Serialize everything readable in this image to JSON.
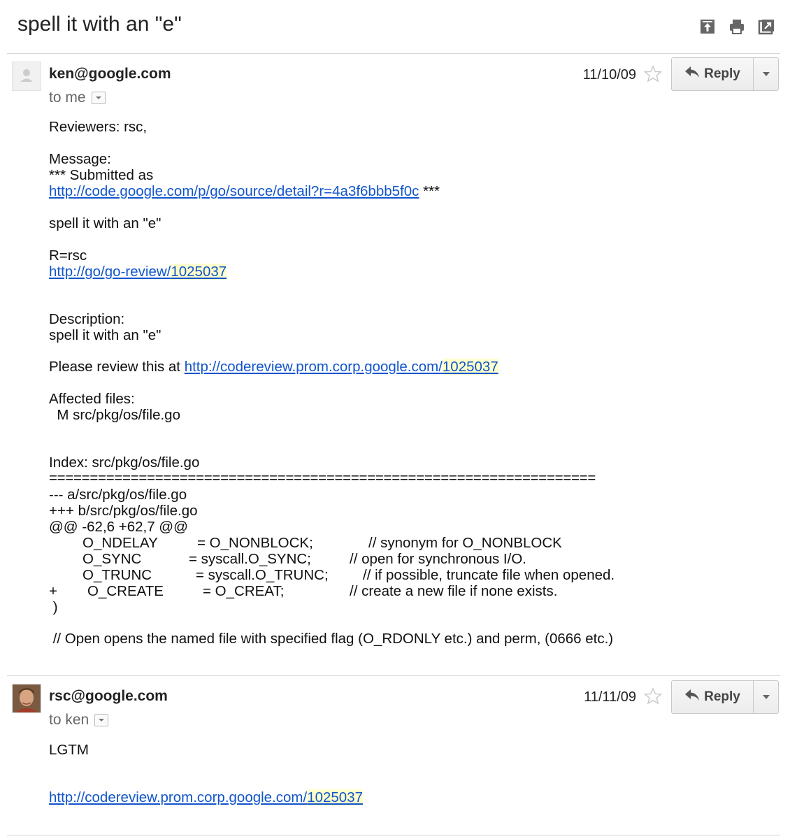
{
  "subject": "spell it with an \"e\"",
  "toolbar": {
    "icons": [
      "archive-up-icon",
      "print-icon",
      "open-new-window-icon"
    ]
  },
  "messages": [
    {
      "sender": "ken@google.com",
      "date": "11/10/09",
      "reply_label": "Reply",
      "to_label": "to me",
      "body": {
        "reviewers": "Reviewers: rsc,",
        "message_label": "Message:",
        "submitted_prefix": "*** Submitted as",
        "submitted_link": "http://code.google.com/p/go/source/detail?r=4a3f6bbb5f0c",
        "submitted_suffix": " ***",
        "summary": "spell it with an \"e\"",
        "r_line": "R=rsc",
        "review_link_base": "http://go/go-review/",
        "review_link_id": "1025037",
        "description_label": "Description:",
        "description_text": "spell it with an \"e\"",
        "please_review_prefix": "Please review this at ",
        "please_review_base": "http://codereview.prom.corp.google.com/",
        "please_review_id": "1025037",
        "affected_label": "Affected files:",
        "affected_file": "  M src/pkg/os/file.go",
        "index_line": "Index: src/pkg/os/file.go",
        "separator": "===================================================================",
        "minus_line": "--- a/src/pkg/os/file.go",
        "plus_line": "+++ b/src/pkg/os/file.go",
        "hunk": "@@ -62,6 +62,7 @@",
        "code": [
          {
            "prefix": "",
            "name": "O_NDELAY",
            "assign": "= O_NONBLOCK;",
            "comment": "// synonym for O_NONBLOCK"
          },
          {
            "prefix": "",
            "name": "O_SYNC",
            "assign": "= syscall.O_SYNC;",
            "comment": "// open for synchronous I/O."
          },
          {
            "prefix": "",
            "name": "O_TRUNC",
            "assign": "= syscall.O_TRUNC;",
            "comment": "// if possible, truncate file when opened."
          },
          {
            "prefix": "+",
            "name": "O_CREATE",
            "assign": "= O_CREAT;",
            "comment": "// create a new file if none exists."
          }
        ],
        "close_paren": " )",
        "open_comment": " // Open opens the named file with specified flag (O_RDONLY etc.) and perm, (0666 etc.)"
      }
    },
    {
      "sender": "rsc@google.com",
      "date": "11/11/09",
      "reply_label": "Reply",
      "to_label": "to ken",
      "body": {
        "text": "LGTM",
        "link_base": "http://codereview.prom.corp.google.com/",
        "link_id": "1025037"
      }
    }
  ]
}
